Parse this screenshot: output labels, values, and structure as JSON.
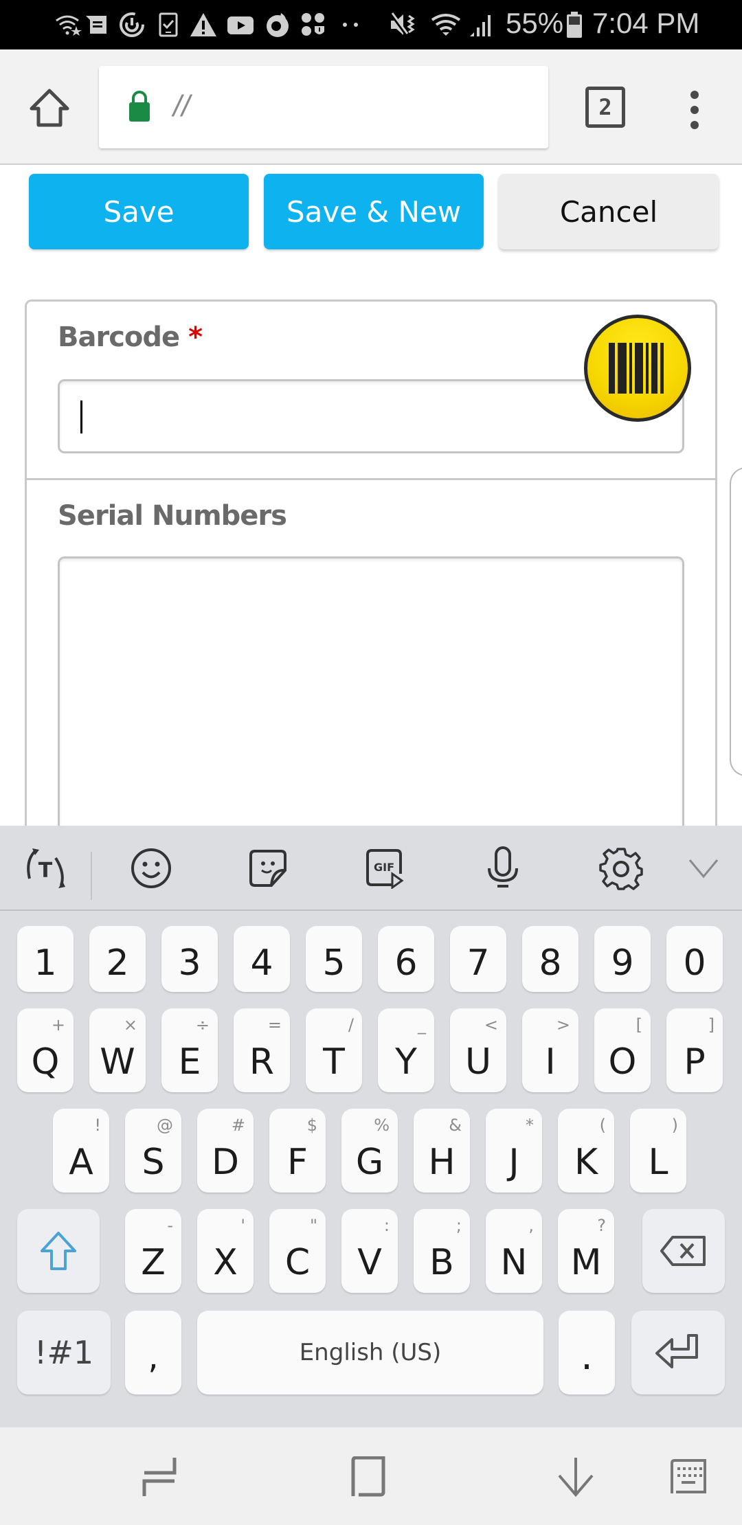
{
  "status_bar": {
    "left_icons": [
      "wifi-star-icon",
      "messages-icon",
      "sync-icon",
      "device-check-icon",
      "warning-icon",
      "youtube-icon",
      "firefox-icon",
      "apps-shield-icon",
      "more-dots-icon"
    ],
    "right_icons": [
      "mute-vibrate-icon",
      "wifi-icon",
      "signal-icon",
      "battery-icon"
    ],
    "battery_percent": "55%",
    "time": "7:04 PM"
  },
  "browser": {
    "url": "//",
    "tab_count": "2",
    "secure": true,
    "lock_color": "#1a8a44"
  },
  "actions": {
    "save_label": "Save",
    "save_new_label": "Save & New",
    "cancel_label": "Cancel",
    "primary_color": "#0db2ef"
  },
  "form": {
    "barcode": {
      "label": "Barcode",
      "required_mark": "*",
      "value": ""
    },
    "serial_numbers": {
      "label": "Serial Numbers",
      "value": ""
    }
  },
  "keyboard": {
    "toolbar_icons": [
      "text-translate-icon",
      "emoji-icon",
      "sticker-icon",
      "gif-icon",
      "microphone-icon",
      "settings-icon",
      "collapse-chevron-icon"
    ],
    "number_row": [
      "1",
      "2",
      "3",
      "4",
      "5",
      "6",
      "7",
      "8",
      "9",
      "0"
    ],
    "row1": [
      {
        "key": "Q",
        "alt": "+"
      },
      {
        "key": "W",
        "alt": "×"
      },
      {
        "key": "E",
        "alt": "÷"
      },
      {
        "key": "R",
        "alt": "="
      },
      {
        "key": "T",
        "alt": "/"
      },
      {
        "key": "Y",
        "alt": "_"
      },
      {
        "key": "U",
        "alt": "<"
      },
      {
        "key": "I",
        "alt": ">"
      },
      {
        "key": "O",
        "alt": "["
      },
      {
        "key": "P",
        "alt": "]"
      }
    ],
    "row2": [
      {
        "key": "A",
        "alt": "!"
      },
      {
        "key": "S",
        "alt": "@"
      },
      {
        "key": "D",
        "alt": "#"
      },
      {
        "key": "F",
        "alt": "$"
      },
      {
        "key": "G",
        "alt": "%"
      },
      {
        "key": "H",
        "alt": "&"
      },
      {
        "key": "J",
        "alt": "*"
      },
      {
        "key": "K",
        "alt": "("
      },
      {
        "key": "L",
        "alt": ")"
      }
    ],
    "row3": [
      {
        "key": "Z",
        "alt": "-"
      },
      {
        "key": "X",
        "alt": "'"
      },
      {
        "key": "C",
        "alt": "\""
      },
      {
        "key": "V",
        "alt": ":"
      },
      {
        "key": "B",
        "alt": ";"
      },
      {
        "key": "N",
        "alt": ","
      },
      {
        "key": "M",
        "alt": "?"
      }
    ],
    "symbols_label": "!#1",
    "comma_label": ",",
    "space_label": "English (US)",
    "period_label": ".",
    "shift_color": "#4aa3d4"
  },
  "navbar": {
    "icons": [
      "recent-apps-icon",
      "home-icon",
      "back-icon",
      "keyboard-switch-icon"
    ]
  }
}
